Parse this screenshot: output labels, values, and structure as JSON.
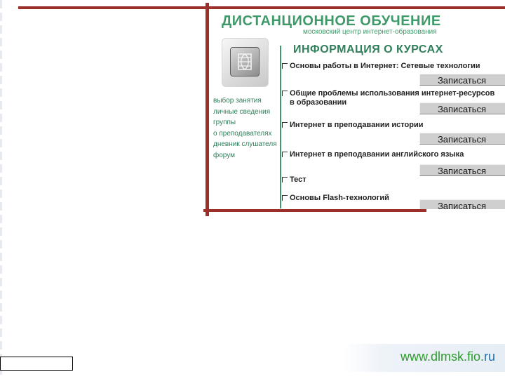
{
  "site": {
    "title": "ДИСТАНЦИОННОЕ ОБУЧЕНИЕ",
    "subtitle": "московский центр интернет-образования",
    "section_title": "ИНФОРМАЦИЯ О КУРСАХ"
  },
  "sidebar": {
    "items": [
      {
        "label": "выбор занятия"
      },
      {
        "label": "личные сведения"
      },
      {
        "label": "группы"
      },
      {
        "label": "о преподавателях"
      },
      {
        "label": "дневник слушателя"
      },
      {
        "label": "форум"
      }
    ]
  },
  "courses": [
    {
      "label": "Основы работы в Интернет: Сетевые технологии",
      "button": "Записаться"
    },
    {
      "label": "Общие проблемы использования интернет-ресурсов",
      "label2": "в образовании",
      "button": "Записаться"
    },
    {
      "label": "Интернет в преподавании истории",
      "button": "Записаться"
    },
    {
      "label": "Интернет в преподавании английского языка",
      "button": "Записаться"
    },
    {
      "label": "Тест",
      "button": "Записаться"
    },
    {
      "label": "Основы Flash-технологий",
      "button": "Записаться"
    }
  ],
  "url": {
    "main": "www.dlmsk.fio.",
    "tld": "ru"
  },
  "colors": {
    "frame": "#9b2f2a",
    "green_text": "#3f9a6a",
    "url_green": "#2f9b2f",
    "url_blue": "#1f6fb5"
  }
}
